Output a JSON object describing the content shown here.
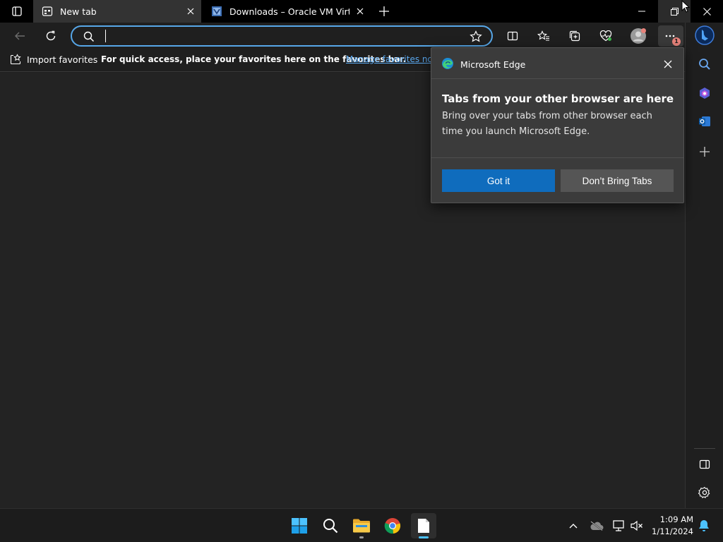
{
  "tabs": [
    {
      "label": "New tab",
      "icon": "new-tab-icon"
    },
    {
      "label": "Downloads – Oracle VM VirtualBox",
      "icon": "virtualbox-icon"
    }
  ],
  "address_bar": {
    "value": "",
    "placeholder": ""
  },
  "favorites_bar": {
    "import_label": "Import favorites",
    "message": "For quick access, place your favorites here on the favorites bar.",
    "manage_link": "Manage favorites now"
  },
  "popup": {
    "app_name": "Microsoft Edge",
    "title": "Tabs from your other browser are here",
    "body": "Bring over your tabs from other browser each time you launch Microsoft Edge.",
    "primary_button": "Got it",
    "secondary_button": "Don’t Bring Tabs"
  },
  "menu_badge": "1",
  "taskbar": {
    "time": "1:09 AM",
    "date": "1/11/2024"
  },
  "colors": {
    "accent": "#0f6cbd",
    "address_border": "#57a7e8",
    "link": "#5aa8ef"
  }
}
